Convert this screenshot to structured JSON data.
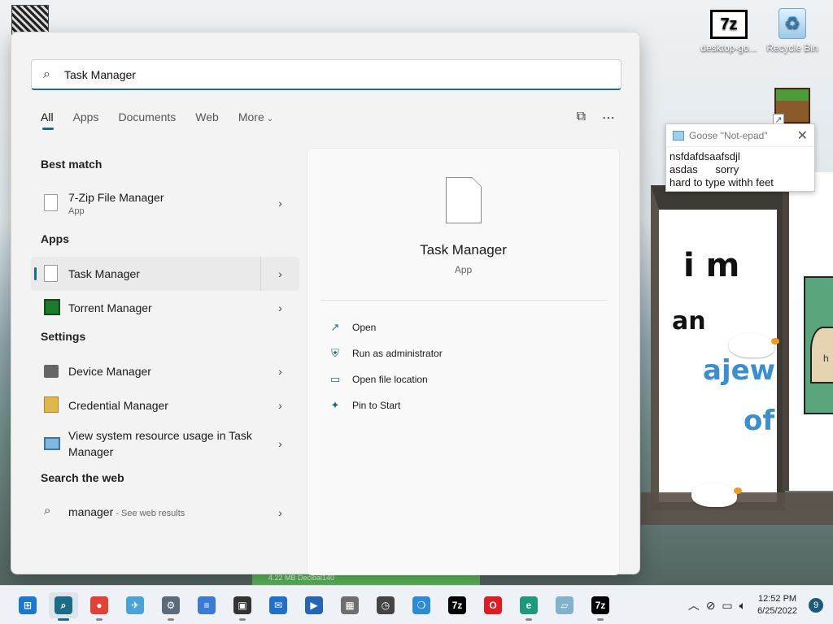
{
  "desktop": {
    "icons": [
      {
        "label": "desktop-go...",
        "glyph": "7z"
      },
      {
        "label": "Recycle Bin",
        "glyph": "♲"
      }
    ],
    "notepad": {
      "title": "Goose \"Not-epad\"",
      "body": "nsfdafdsaafsdjl\nasdas      sorry\nhard to type withh feet"
    },
    "meme": {
      "line1": "i m",
      "line2": "an",
      "line3": "ajew",
      "line4": "of",
      "side": "h"
    },
    "green_bar": "4.22 MB   Decibal140"
  },
  "search": {
    "value": "Task Manager",
    "tabs": [
      {
        "label": "All"
      },
      {
        "label": "Apps"
      },
      {
        "label": "Documents"
      },
      {
        "label": "Web"
      },
      {
        "label": "More"
      }
    ],
    "sections": {
      "best_match": "Best match",
      "apps": "Apps",
      "settings": "Settings",
      "web": "Search the web"
    },
    "best_match": {
      "name": "7-Zip File Manager",
      "type": "App"
    },
    "apps": [
      {
        "name": "Task Manager"
      },
      {
        "name": "Torrent Manager"
      }
    ],
    "settings": [
      {
        "name": "Device Manager"
      },
      {
        "name": "Credential Manager"
      },
      {
        "name": "View system resource usage in Task Manager"
      }
    ],
    "web": {
      "query": "manager",
      "suffix": " - See web results"
    }
  },
  "preview": {
    "title": "Task Manager",
    "type": "App",
    "actions": [
      {
        "label": "Open",
        "icon": "open-icon"
      },
      {
        "label": "Run as administrator",
        "icon": "shield-icon"
      },
      {
        "label": "Open file location",
        "icon": "folder-icon"
      },
      {
        "label": "Pin to Start",
        "icon": "pin-icon"
      }
    ]
  },
  "taskbar": {
    "time": "12:52 PM",
    "date": "6/25/2022",
    "notifications": "9",
    "apps": [
      {
        "name": "start",
        "color": "#1a78d4"
      },
      {
        "name": "search",
        "color": "#1a6b87"
      },
      {
        "name": "chrome",
        "color": "#e44134"
      },
      {
        "name": "maps",
        "color": "#4aa3d8"
      },
      {
        "name": "settings",
        "color": "#5b6b7b"
      },
      {
        "name": "notepad",
        "color": "#3a7bd5"
      },
      {
        "name": "store",
        "color": "#333333"
      },
      {
        "name": "mail",
        "color": "#1f6fcf"
      },
      {
        "name": "powerautomate",
        "color": "#2565b8"
      },
      {
        "name": "calculator",
        "color": "#6e6e6e"
      },
      {
        "name": "clock",
        "color": "#444444"
      },
      {
        "name": "tips",
        "color": "#2a8bd8"
      },
      {
        "name": "7zip",
        "color": "#000000"
      },
      {
        "name": "opera",
        "color": "#e01b24"
      },
      {
        "name": "edge",
        "color": "#1b9a7c"
      },
      {
        "name": "notepad2",
        "color": "#7fb3cc"
      },
      {
        "name": "7zip2",
        "color": "#000000"
      }
    ]
  }
}
